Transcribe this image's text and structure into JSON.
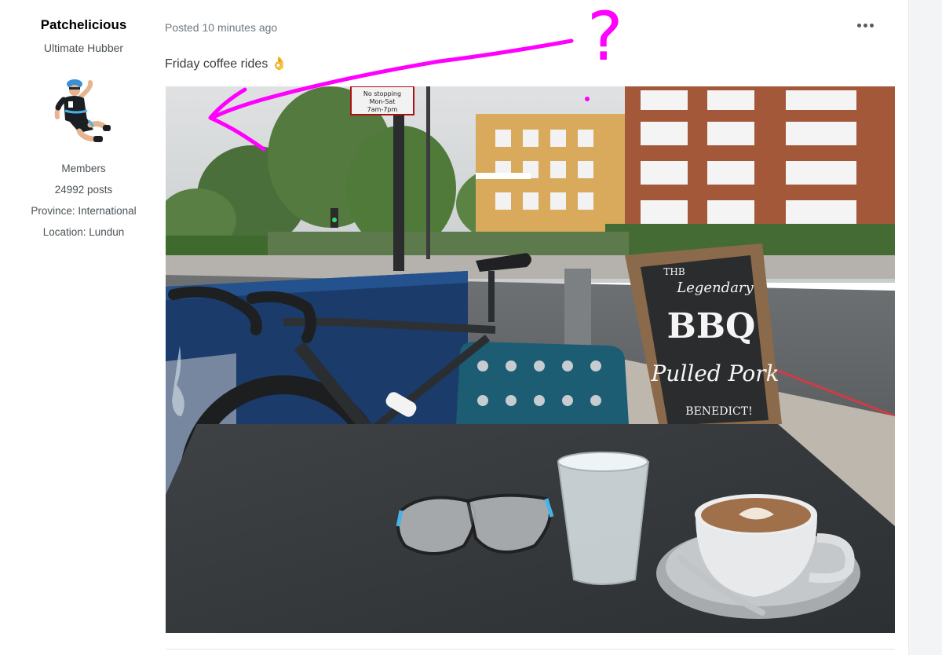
{
  "author": {
    "name": "Patchelicious",
    "title": "Ultimate Hubber",
    "group": "Members",
    "posts": "24992 posts",
    "province": "Province: International",
    "location": "Location: Lundun"
  },
  "post": {
    "posted": "Posted 10 minutes ago",
    "text": "Friday coffee rides 👌",
    "more_icon": "ellipsis-icon",
    "photo": {
      "sign_parking": [
        "No stopping",
        "Mon-Sat",
        "7am-7pm"
      ],
      "sign_board": [
        "THB",
        "Legendary",
        "BBQ",
        "Pulled Pork",
        "BENEDICT!"
      ]
    }
  },
  "annotation": {
    "symbol": "?",
    "color": "#ff00ff"
  }
}
